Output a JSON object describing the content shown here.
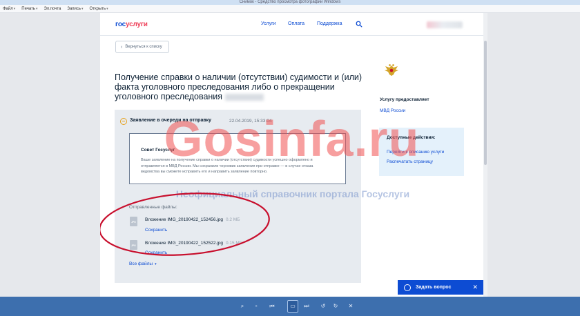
{
  "window": {
    "title": "Снимок - Средство просмотра фотографий Windows"
  },
  "menubar": [
    {
      "label": "Файл"
    },
    {
      "label": "Печать"
    },
    {
      "label": "Эл.почта"
    },
    {
      "label": "Запись"
    },
    {
      "label": "Открыть"
    }
  ],
  "header": {
    "logo_part1": "гос",
    "logo_part2": "услуги",
    "nav": [
      {
        "label": "Услуги"
      },
      {
        "label": "Оплата"
      },
      {
        "label": "Поддержка"
      }
    ]
  },
  "back_button": {
    "label": "Вернуться к списку"
  },
  "page_title": "Получение справки о наличии (отсутствии) судимости и (или) факта уголовного преследования либо о прекращении уголовного преследования",
  "status": {
    "text": "Заявление в очереди на отправку",
    "date": "22.04.2019, 15:33:04",
    "advice_title": "Совет Госуслуг",
    "advice_text": "Ваше заявление на получение справки о наличии (отсутствии) судимости успешно оформлено и отправляется в МВД России. Мы сохранили черновик заявления при отправке — в случае отказа ведомства вы сможете исправить его и направить заявление повторно."
  },
  "files": {
    "label": "Отправленные файлы:",
    "items": [
      {
        "name": "Вложение IMG_20190422_152456.jpg",
        "size": "0.2 МБ",
        "save": "Сохранить",
        "type": "JPG"
      },
      {
        "name": "Вложение IMG_20190422_152522.jpg",
        "size": "0.15 МБ",
        "save": "Сохранить",
        "type": "JPG"
      }
    ],
    "all_files": "Все файлы"
  },
  "provider": {
    "title": "Услугу предоставляет",
    "name": "МВД России"
  },
  "actions": {
    "title": "Доступные действия:",
    "items": [
      {
        "label": "Перейти к описанию услуги"
      },
      {
        "label": "Распечатать страницу"
      }
    ]
  },
  "watermark": {
    "big": "Gosinfa.ru",
    "small": "Неофициальный справочник портала Госуслуги"
  },
  "ask": {
    "label": "Задать вопрос"
  },
  "colors": {
    "brand_blue": "#0d4cd3",
    "brand_red": "#ee3f58",
    "status_orange": "#e6a019",
    "annotation_red": "#c8102e"
  }
}
